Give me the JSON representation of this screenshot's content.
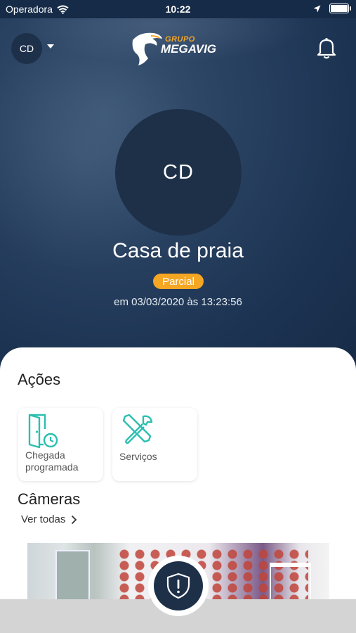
{
  "status_bar": {
    "carrier": "Operadora",
    "time": "10:22"
  },
  "header": {
    "account_initials": "CD",
    "logo": {
      "top_text": "GRUPO",
      "brand": "MEGAVIG"
    }
  },
  "profile": {
    "initials": "CD",
    "name": "Casa de praia",
    "status_badge": "Parcial",
    "updated": "em 03/03/2020 às 13:23:56"
  },
  "actions": {
    "title": "Ações",
    "items": [
      {
        "label": "Chegada programada",
        "icon": "scheduled-arrival-door-clock-icon"
      },
      {
        "label": "Serviços",
        "icon": "tools-icon"
      }
    ]
  },
  "cameras": {
    "title": "Câmeras",
    "see_all": "Ver todas"
  },
  "colors": {
    "accent_teal": "#2bbfb0",
    "badge_orange": "#f5a623",
    "navy": "#1d3048"
  }
}
